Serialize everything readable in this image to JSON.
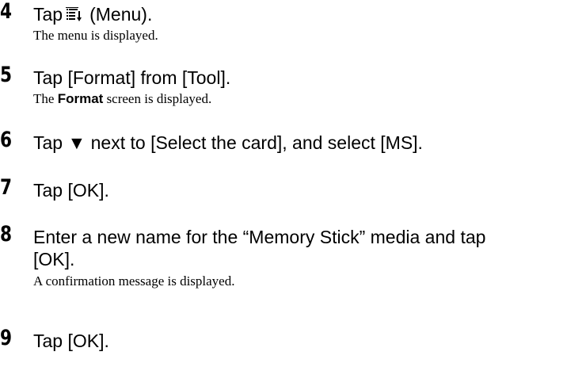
{
  "steps": [
    {
      "number": "4",
      "title_before": "Tap",
      "icon": "menu-icon",
      "title_after": "(Menu).",
      "description": "The menu is displayed."
    },
    {
      "number": "5",
      "title": "Tap [Format] from [Tool].",
      "desc_bold": "Format",
      "desc_after": " screen is displayed.",
      "desc_before": "The "
    },
    {
      "number": "6",
      "title": "Tap ▼ next to [Select the card], and select [MS]."
    },
    {
      "number": "7",
      "title": "Tap [OK]."
    },
    {
      "number": "8",
      "title_line1": "Enter a new name for the “Memory Stick” media and tap",
      "title_line2": "[OK].",
      "description": "A confirmation message is displayed."
    },
    {
      "number": "9",
      "title": "Tap [OK]."
    }
  ]
}
